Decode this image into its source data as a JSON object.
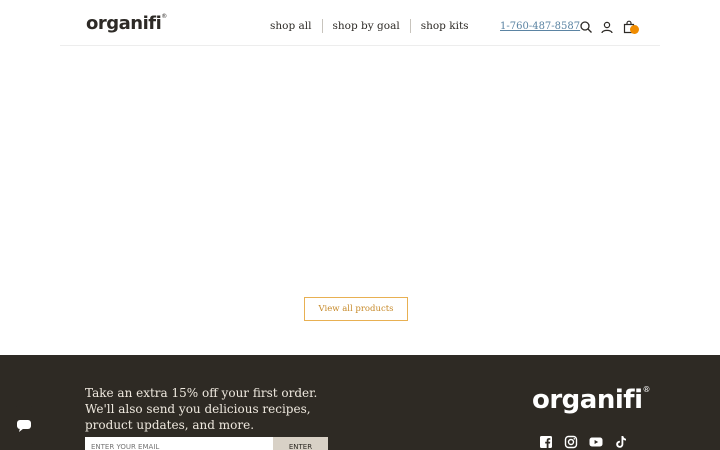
{
  "header": {
    "logo": "organifi",
    "logo_mark": "®",
    "nav": [
      "shop all",
      "shop by goal",
      "shop kits"
    ],
    "phone": "1-760-487-8587"
  },
  "main": {
    "view_all_label": "View all products"
  },
  "footer": {
    "promo_line1": "Take an extra 15% off your first order.",
    "promo_line2": "We'll also send you delicious recipes, product updates, and more.",
    "email_placeholder": "ENTER YOUR EMAIL",
    "enter_label": "ENTER",
    "logo": "organifi",
    "logo_mark": "®"
  },
  "colors": {
    "accent": "#f08c00",
    "footer_bg": "#2e2a24",
    "link": "#5b84a3"
  },
  "icons": [
    "search-icon",
    "account-icon",
    "cart-icon",
    "facebook-icon",
    "instagram-icon",
    "youtube-icon",
    "tiktok-icon",
    "chat-icon"
  ]
}
